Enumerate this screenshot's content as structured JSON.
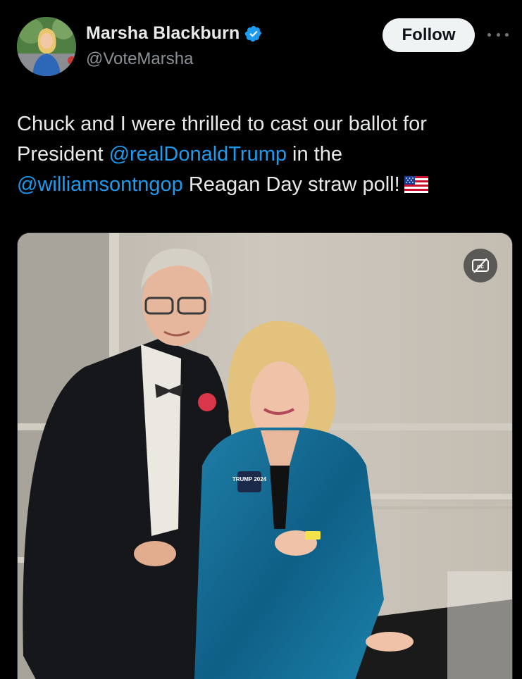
{
  "author": {
    "display_name": "Marsha Blackburn",
    "handle": "@VoteMarsha",
    "verified": true,
    "verified_icon": "verified-badge-icon",
    "avatar_icon": "profile-photo"
  },
  "actions": {
    "follow_label": "Follow",
    "more_icon": "more-options-icon"
  },
  "tweet": {
    "text_part1": "Chuck and I were thrilled to cast our ballot for President ",
    "mention1": "@realDonaldTrump",
    "text_part2": " in the ",
    "mention2": "@williamsontngop",
    "text_part3": " Reagan Day straw poll!",
    "emoji": "us-flag-icon"
  },
  "media": {
    "type": "photo",
    "caption_toggle_icon": "closed-captions-off-icon",
    "pin_text": "TRUMP 2024"
  },
  "colors": {
    "background": "#000000",
    "text": "#e7e9ea",
    "secondary_text": "#8b9196",
    "link": "#1d9bf0",
    "verified": "#1d9bf0",
    "follow_button_bg": "#eff3f4"
  }
}
